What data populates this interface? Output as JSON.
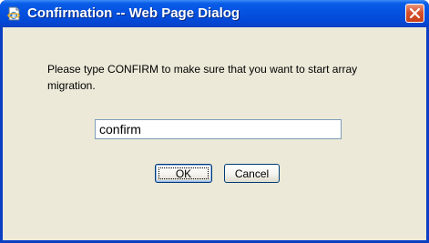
{
  "window": {
    "title": "Confirmation -- Web Page Dialog",
    "title_icon": "ie-page-icon",
    "close_icon": "close-icon"
  },
  "dialog": {
    "message": "Please type CONFIRM to make sure that you want to start array migration.",
    "input_value": "confirm",
    "ok_label": "OK",
    "cancel_label": "Cancel"
  },
  "colors": {
    "titlebar": "#0553e1",
    "client_background": "#ece9d8",
    "close_button": "#d7512c",
    "input_border": "#7f9db9"
  }
}
